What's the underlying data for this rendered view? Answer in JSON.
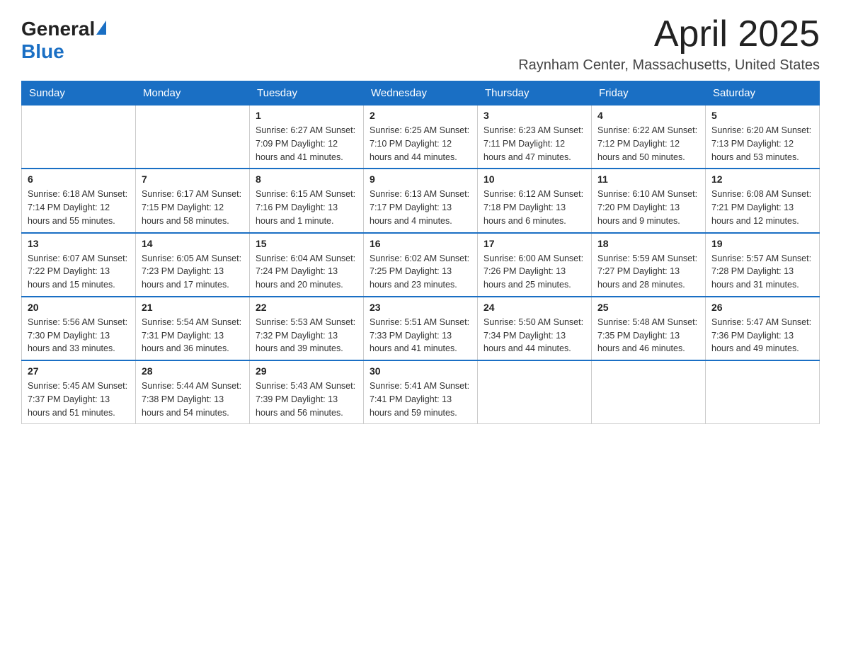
{
  "logo": {
    "general": "General",
    "blue": "Blue"
  },
  "title": "April 2025",
  "subtitle": "Raynham Center, Massachusetts, United States",
  "weekdays": [
    "Sunday",
    "Monday",
    "Tuesday",
    "Wednesday",
    "Thursday",
    "Friday",
    "Saturday"
  ],
  "weeks": [
    [
      {
        "day": "",
        "info": ""
      },
      {
        "day": "",
        "info": ""
      },
      {
        "day": "1",
        "info": "Sunrise: 6:27 AM\nSunset: 7:09 PM\nDaylight: 12 hours\nand 41 minutes."
      },
      {
        "day": "2",
        "info": "Sunrise: 6:25 AM\nSunset: 7:10 PM\nDaylight: 12 hours\nand 44 minutes."
      },
      {
        "day": "3",
        "info": "Sunrise: 6:23 AM\nSunset: 7:11 PM\nDaylight: 12 hours\nand 47 minutes."
      },
      {
        "day": "4",
        "info": "Sunrise: 6:22 AM\nSunset: 7:12 PM\nDaylight: 12 hours\nand 50 minutes."
      },
      {
        "day": "5",
        "info": "Sunrise: 6:20 AM\nSunset: 7:13 PM\nDaylight: 12 hours\nand 53 minutes."
      }
    ],
    [
      {
        "day": "6",
        "info": "Sunrise: 6:18 AM\nSunset: 7:14 PM\nDaylight: 12 hours\nand 55 minutes."
      },
      {
        "day": "7",
        "info": "Sunrise: 6:17 AM\nSunset: 7:15 PM\nDaylight: 12 hours\nand 58 minutes."
      },
      {
        "day": "8",
        "info": "Sunrise: 6:15 AM\nSunset: 7:16 PM\nDaylight: 13 hours\nand 1 minute."
      },
      {
        "day": "9",
        "info": "Sunrise: 6:13 AM\nSunset: 7:17 PM\nDaylight: 13 hours\nand 4 minutes."
      },
      {
        "day": "10",
        "info": "Sunrise: 6:12 AM\nSunset: 7:18 PM\nDaylight: 13 hours\nand 6 minutes."
      },
      {
        "day": "11",
        "info": "Sunrise: 6:10 AM\nSunset: 7:20 PM\nDaylight: 13 hours\nand 9 minutes."
      },
      {
        "day": "12",
        "info": "Sunrise: 6:08 AM\nSunset: 7:21 PM\nDaylight: 13 hours\nand 12 minutes."
      }
    ],
    [
      {
        "day": "13",
        "info": "Sunrise: 6:07 AM\nSunset: 7:22 PM\nDaylight: 13 hours\nand 15 minutes."
      },
      {
        "day": "14",
        "info": "Sunrise: 6:05 AM\nSunset: 7:23 PM\nDaylight: 13 hours\nand 17 minutes."
      },
      {
        "day": "15",
        "info": "Sunrise: 6:04 AM\nSunset: 7:24 PM\nDaylight: 13 hours\nand 20 minutes."
      },
      {
        "day": "16",
        "info": "Sunrise: 6:02 AM\nSunset: 7:25 PM\nDaylight: 13 hours\nand 23 minutes."
      },
      {
        "day": "17",
        "info": "Sunrise: 6:00 AM\nSunset: 7:26 PM\nDaylight: 13 hours\nand 25 minutes."
      },
      {
        "day": "18",
        "info": "Sunrise: 5:59 AM\nSunset: 7:27 PM\nDaylight: 13 hours\nand 28 minutes."
      },
      {
        "day": "19",
        "info": "Sunrise: 5:57 AM\nSunset: 7:28 PM\nDaylight: 13 hours\nand 31 minutes."
      }
    ],
    [
      {
        "day": "20",
        "info": "Sunrise: 5:56 AM\nSunset: 7:30 PM\nDaylight: 13 hours\nand 33 minutes."
      },
      {
        "day": "21",
        "info": "Sunrise: 5:54 AM\nSunset: 7:31 PM\nDaylight: 13 hours\nand 36 minutes."
      },
      {
        "day": "22",
        "info": "Sunrise: 5:53 AM\nSunset: 7:32 PM\nDaylight: 13 hours\nand 39 minutes."
      },
      {
        "day": "23",
        "info": "Sunrise: 5:51 AM\nSunset: 7:33 PM\nDaylight: 13 hours\nand 41 minutes."
      },
      {
        "day": "24",
        "info": "Sunrise: 5:50 AM\nSunset: 7:34 PM\nDaylight: 13 hours\nand 44 minutes."
      },
      {
        "day": "25",
        "info": "Sunrise: 5:48 AM\nSunset: 7:35 PM\nDaylight: 13 hours\nand 46 minutes."
      },
      {
        "day": "26",
        "info": "Sunrise: 5:47 AM\nSunset: 7:36 PM\nDaylight: 13 hours\nand 49 minutes."
      }
    ],
    [
      {
        "day": "27",
        "info": "Sunrise: 5:45 AM\nSunset: 7:37 PM\nDaylight: 13 hours\nand 51 minutes."
      },
      {
        "day": "28",
        "info": "Sunrise: 5:44 AM\nSunset: 7:38 PM\nDaylight: 13 hours\nand 54 minutes."
      },
      {
        "day": "29",
        "info": "Sunrise: 5:43 AM\nSunset: 7:39 PM\nDaylight: 13 hours\nand 56 minutes."
      },
      {
        "day": "30",
        "info": "Sunrise: 5:41 AM\nSunset: 7:41 PM\nDaylight: 13 hours\nand 59 minutes."
      },
      {
        "day": "",
        "info": ""
      },
      {
        "day": "",
        "info": ""
      },
      {
        "day": "",
        "info": ""
      }
    ]
  ]
}
